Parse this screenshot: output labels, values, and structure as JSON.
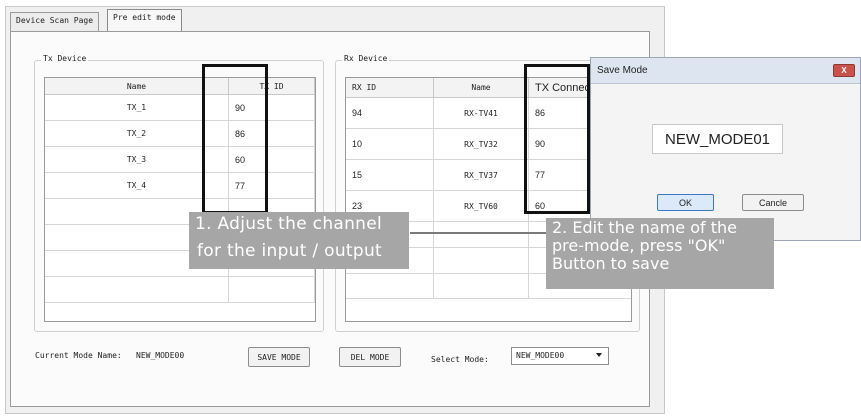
{
  "tabs": [
    "Device Scan Page",
    "Pre edit mode"
  ],
  "tx_device": {
    "title": "Tx Device",
    "columns": [
      "Name",
      "TX ID"
    ],
    "rows": [
      {
        "name": "TX_1",
        "id": "90"
      },
      {
        "name": "TX_2",
        "id": "86"
      },
      {
        "name": "TX_3",
        "id": "60"
      },
      {
        "name": "TX_4",
        "id": "77"
      }
    ]
  },
  "rx_device": {
    "title": "Rx Device",
    "columns": [
      "RX ID",
      "Name",
      "TX Connect"
    ],
    "rows": [
      {
        "id": "94",
        "name": "RX-TV41",
        "connect": "86"
      },
      {
        "id": "10",
        "name": "RX_TV32",
        "connect": "90"
      },
      {
        "id": "15",
        "name": "RX_TV37",
        "connect": "77"
      },
      {
        "id": "23",
        "name": "RX_TV60",
        "connect": "60"
      }
    ]
  },
  "bottom": {
    "current_mode_label": "Current Mode Name:",
    "current_mode_value": "NEW_MODE00",
    "save_button": "SAVE MODE",
    "del_button": "DEL MODE",
    "select_mode_label": "Select Mode:",
    "select_mode_value": "NEW_MODE00"
  },
  "dialog": {
    "title": "Save Mode",
    "close_label": "X",
    "mode_name": "NEW_MODE01",
    "ok_label": "OK",
    "cancel_label": "Cancle"
  },
  "callouts": {
    "left_line1": "1. Adjust the channel",
    "left_line2": "for the input / output",
    "right_line1": "2. Edit the name of the",
    "right_line2": "pre-mode, press \"OK\"",
    "right_line3": "Button to save"
  },
  "colors": {
    "callout_bg": "#a6a6a6",
    "highlight_border": "#111111",
    "ok_button_bg": "#dbe9f8"
  }
}
